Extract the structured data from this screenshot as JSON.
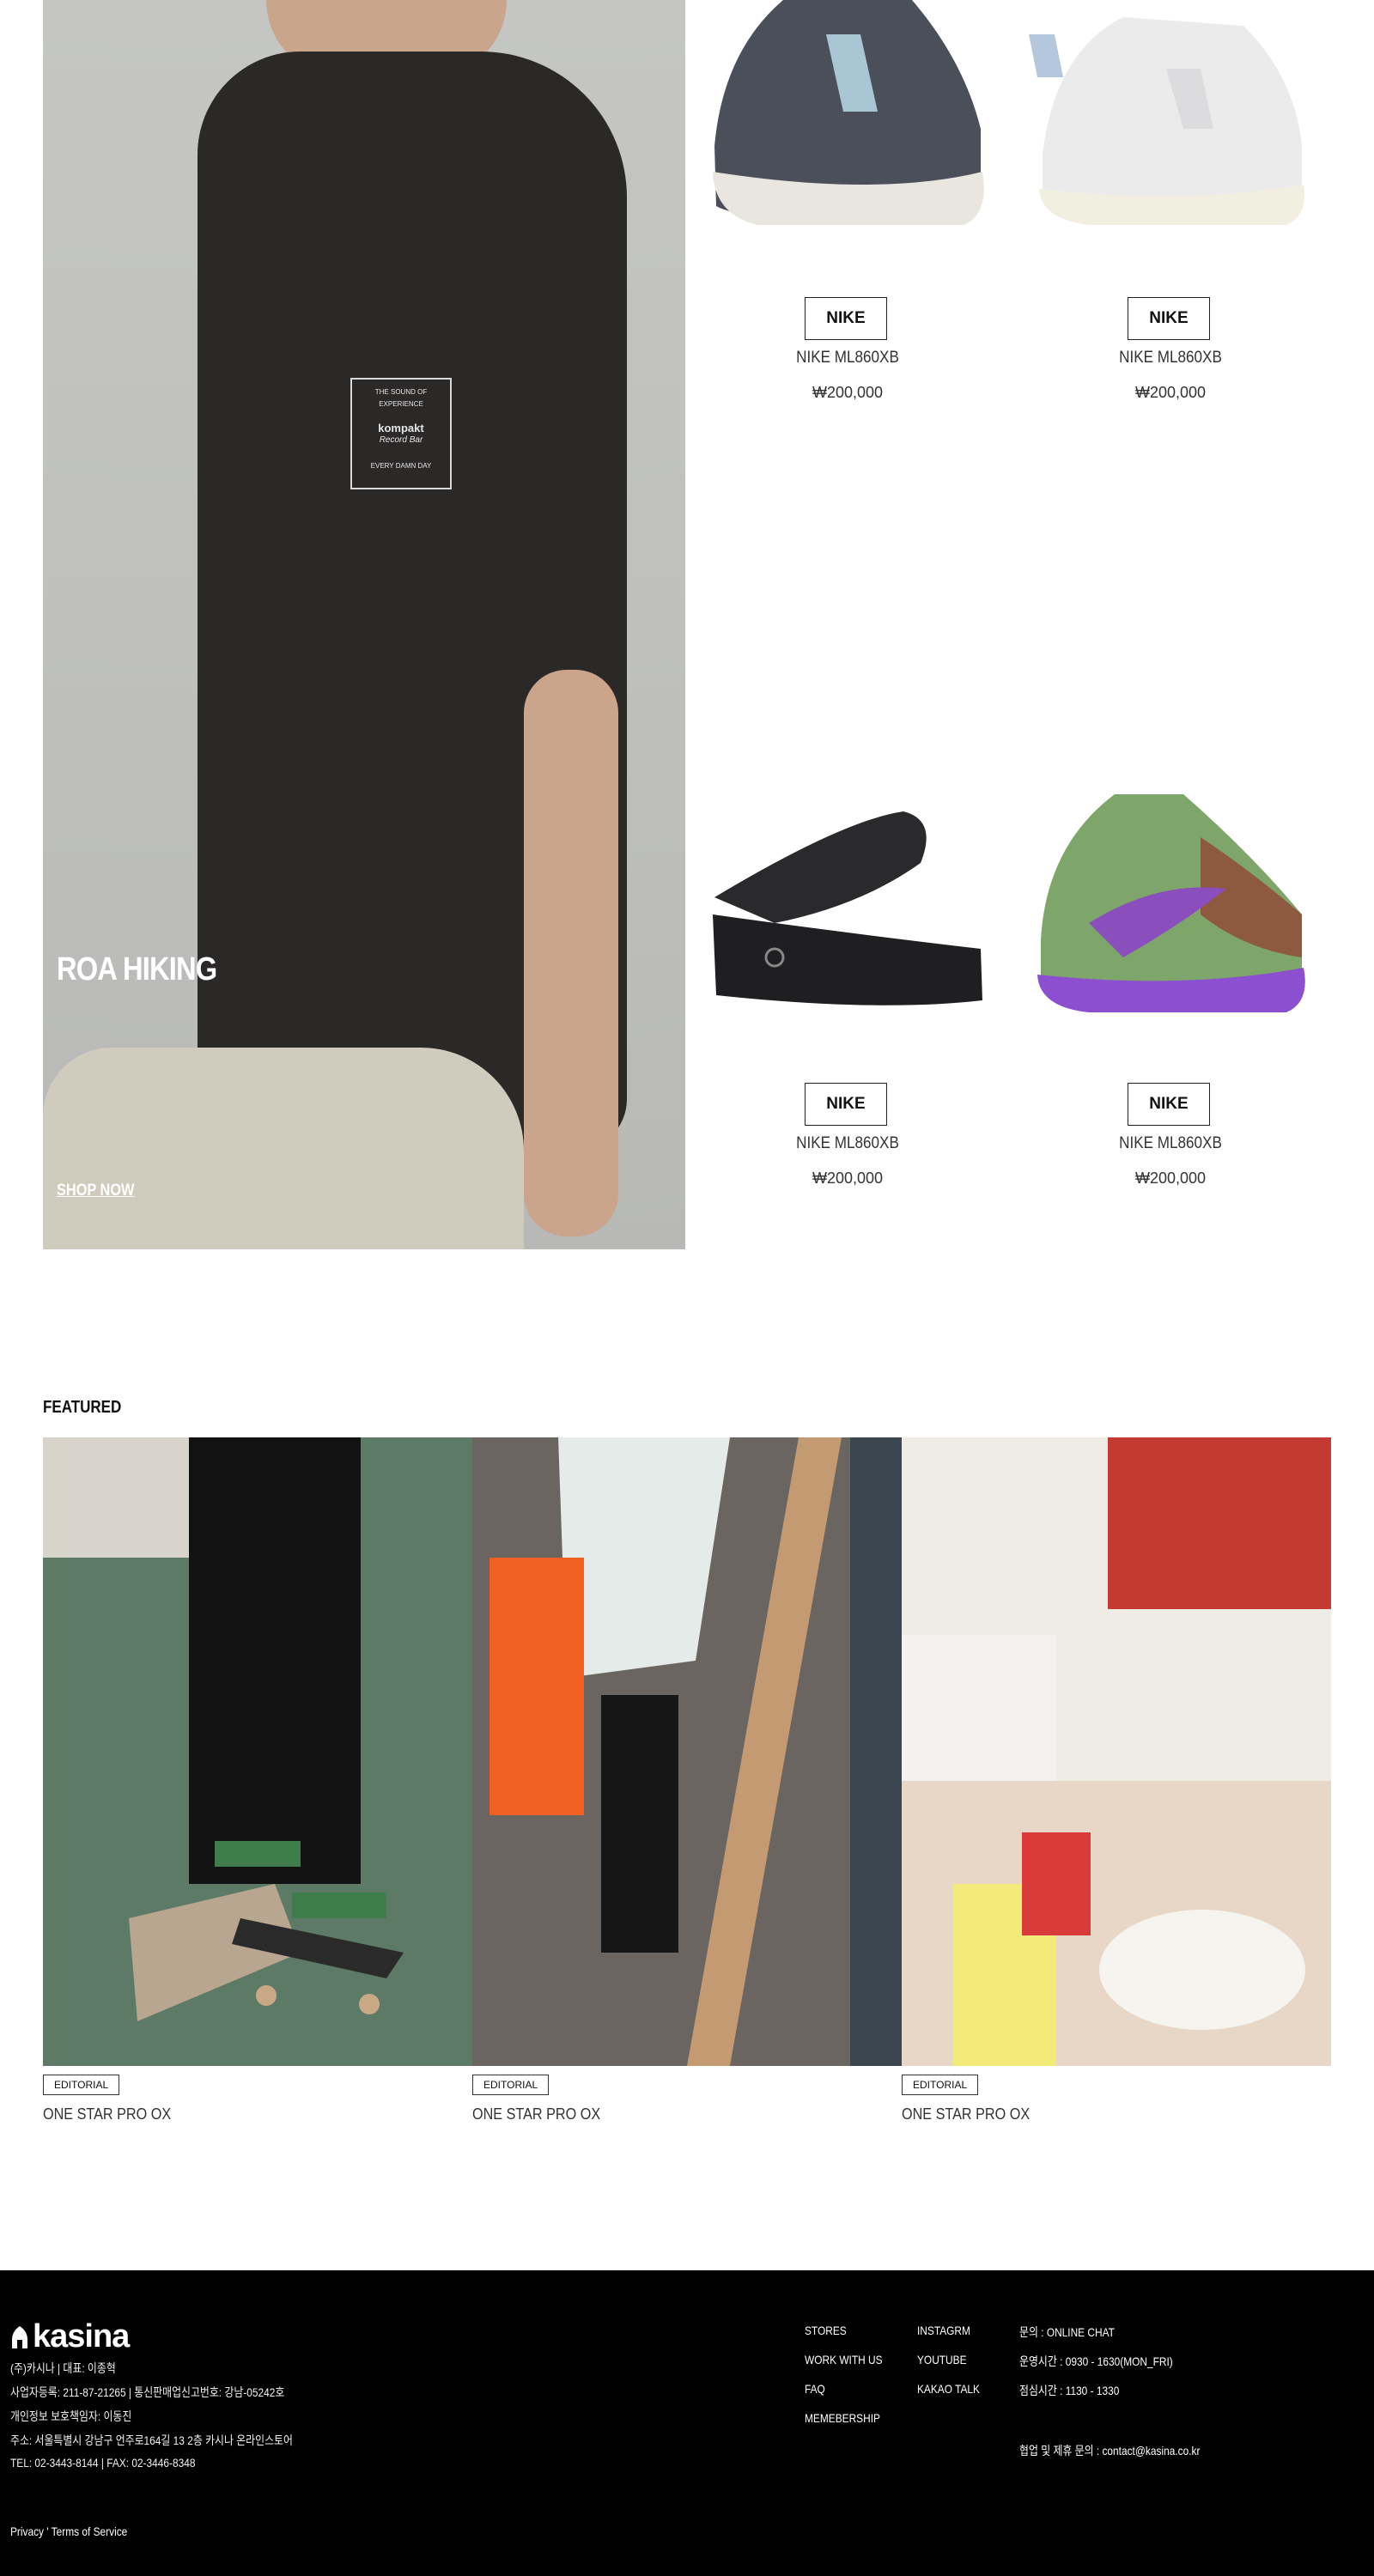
{
  "hero": {
    "title": "ROA HIKING",
    "cta": "SHOP NOW",
    "print_lines": [
      "THE SOUND OF EXPERIENCE",
      "kompakt",
      "Record Bar",
      "EVERY DAMN DAY"
    ]
  },
  "products": [
    {
      "brand": "NIKE",
      "name": "NIKE ML860XB",
      "price": "₩200,000",
      "colors": {
        "body": "#4a4f5a",
        "accent": "#a9c6d4",
        "sole": "#e8e6df"
      }
    },
    {
      "brand": "NIKE",
      "name": "NIKE ML860XB",
      "price": "₩200,000",
      "colors": {
        "body": "#ecebec",
        "accent": "#b5c7dd",
        "sole": "#f1efdf"
      }
    },
    {
      "brand": "NIKE",
      "name": "NIKE ML860XB",
      "price": "₩200,000",
      "colors": {
        "body": "#2a2a2c",
        "accent": "#3a3a3c",
        "sole": "#1f1f21"
      }
    },
    {
      "brand": "NIKE",
      "name": "NIKE ML860XB",
      "price": "₩200,000",
      "colors": {
        "body": "#7fa66a",
        "accent": "#8a4fbd",
        "sole": "#8b4fd0"
      }
    }
  ],
  "featured": {
    "title": "FEATURED",
    "items": [
      {
        "tag": "EDITORIAL",
        "name": "ONE STAR PRO OX"
      },
      {
        "tag": "EDITORIAL",
        "name": "ONE STAR PRO OX"
      },
      {
        "tag": "EDITORIAL",
        "name": "ONE STAR PRO OX"
      }
    ]
  },
  "footer": {
    "logo": "kasina",
    "company_lines": [
      "(주)카시나 | 대표: 이종혁",
      "사업자등록: 211-87-21265 | 통신판매업신고번호: 강남-05242호",
      "개인정보 보호책임자: 이동진",
      "주소: 서울특별시 강남구 언주로164길 13 2층 카시나 온라인스토어",
      "TEL: 02-3443-8144 | FAX: 02-3446-8348"
    ],
    "links_col1": [
      "STORES",
      "WORK WITH US",
      "FAQ",
      "MEMEBERSHIP"
    ],
    "links_col2": [
      "INSTAGRM",
      "YOUTUBE",
      "KAKAO TALK"
    ],
    "contact_lines": [
      "문의 : ONLINE CHAT",
      "운영시간 : 0930 - 1630(MON_FRI)",
      "점심시간 : 1130 - 1330"
    ],
    "partnership": "협업 및 제휴 문의 : contact@kasina.co.kr",
    "legal": "Privacy ' Terms of Service"
  }
}
